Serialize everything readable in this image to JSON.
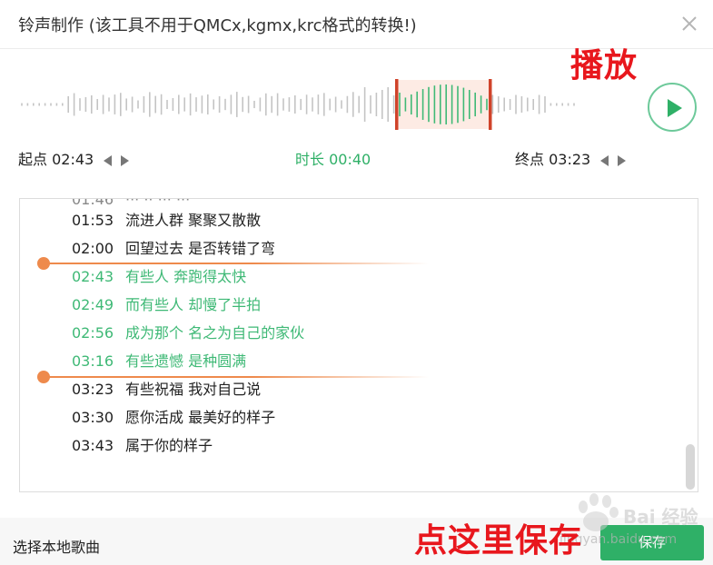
{
  "window": {
    "title": "铃声制作 (该工具不用于QMCx,kgmx,krc格式的转换!)",
    "close_icon": "close-icon"
  },
  "annotations": {
    "play": "播放",
    "save": "点这里保存"
  },
  "player": {
    "play_icon": "play-icon",
    "start_label": "起点",
    "start_time": "02:43",
    "duration_label": "时长",
    "duration_time": "00:40",
    "end_label": "终点",
    "end_time": "03:23"
  },
  "lyrics": {
    "rows": [
      {
        "time": "01:53",
        "text": "流进人群 聚聚又散散"
      },
      {
        "time": "02:00",
        "text": "回望过去 是否转错了弯"
      },
      {
        "time": "02:43",
        "text": "有些人 奔跑得太快"
      },
      {
        "time": "02:49",
        "text": "而有些人 却慢了半拍"
      },
      {
        "time": "02:56",
        "text": "成为那个 名之为自己的家伙"
      },
      {
        "time": "03:16",
        "text": "有些遗憾 是种圆满"
      },
      {
        "time": "03:23",
        "text": "有些祝福 我对自己说"
      },
      {
        "time": "03:30",
        "text": "愿你活成 最美好的样子"
      },
      {
        "time": "03:43",
        "text": "属于你的样子"
      }
    ]
  },
  "footer": {
    "local_song": "选择本地歌曲",
    "save_label": "保存"
  },
  "watermark": {
    "text": "Bai 经验",
    "url": "jingyan.baidu.com"
  },
  "colors": {
    "accent_green": "#2fb067",
    "selection_green": "#3fb976",
    "marker_orange": "#ee8a4c",
    "waveform_selected_red": "#d0432a",
    "annotation_red": "#e8171d"
  }
}
